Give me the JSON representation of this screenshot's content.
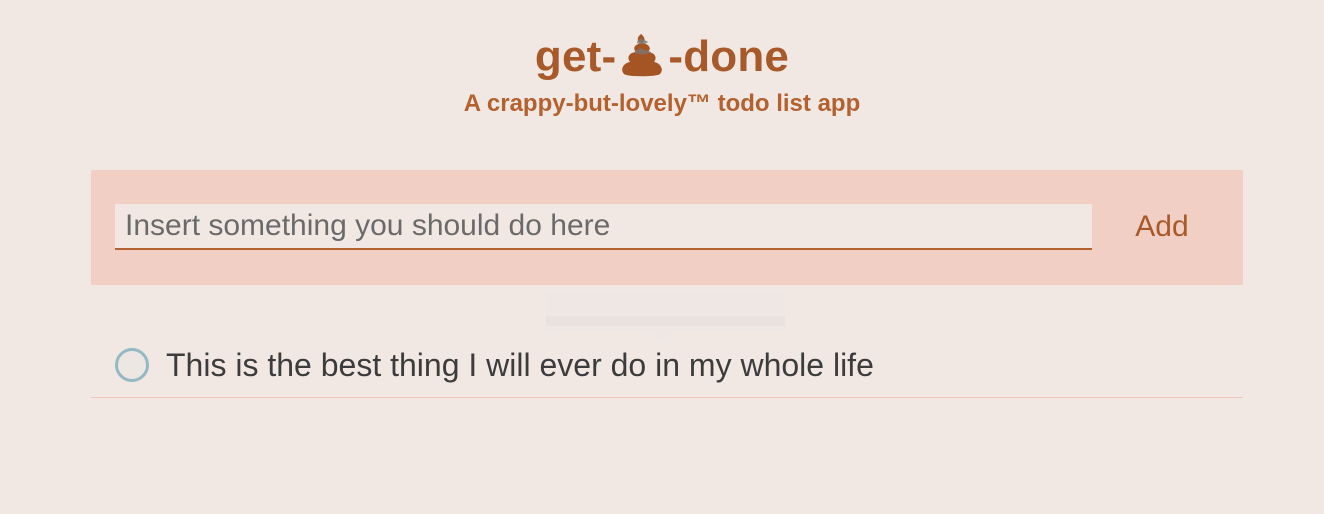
{
  "header": {
    "title_before": "get-",
    "title_icon": "poop-emoji",
    "title_after": "-done",
    "subtitle": "A crappy-but-lovely™ todo list app"
  },
  "add_form": {
    "placeholder": "Insert something you should do here",
    "value": "",
    "add_label": "Add"
  },
  "todos": [
    {
      "text": "This is the best thing I will ever do in my whole life",
      "done": false
    }
  ],
  "colors": {
    "background": "#f2e8e3",
    "accent": "#a8592a",
    "panel": "#f2cfc4",
    "checkbox_border": "#95b9c4"
  }
}
